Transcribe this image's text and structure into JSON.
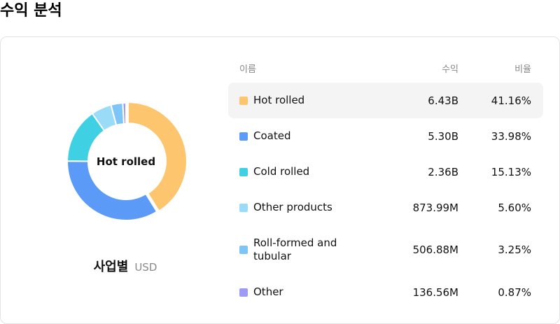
{
  "page": {
    "title": "수익 분석"
  },
  "table": {
    "headers": {
      "name": "이름",
      "revenue": "수익",
      "share": "비율"
    }
  },
  "caption": {
    "title": "사업별",
    "unit": "USD"
  },
  "chart_data": {
    "type": "pie",
    "center_label": "Hot rolled",
    "categories": [
      "Hot rolled",
      "Coated",
      "Cold rolled",
      "Other products",
      "Roll-formed and tubular",
      "Other"
    ],
    "values_label": [
      "6.43B",
      "5.30B",
      "2.36B",
      "873.99M",
      "506.88M",
      "136.56M"
    ],
    "values": [
      6430000000,
      5300000000,
      2360000000,
      873990000,
      506880000,
      136560000
    ],
    "shares_label": [
      "41.16%",
      "33.98%",
      "15.13%",
      "5.60%",
      "3.25%",
      "0.87%"
    ],
    "shares": [
      41.16,
      33.98,
      15.13,
      5.6,
      3.25,
      0.87
    ],
    "colors": [
      "#fec56f",
      "#5b9bf7",
      "#40d0e4",
      "#9adbf8",
      "#7dc5f7",
      "#9d9cf4"
    ],
    "selected_index": 0
  }
}
